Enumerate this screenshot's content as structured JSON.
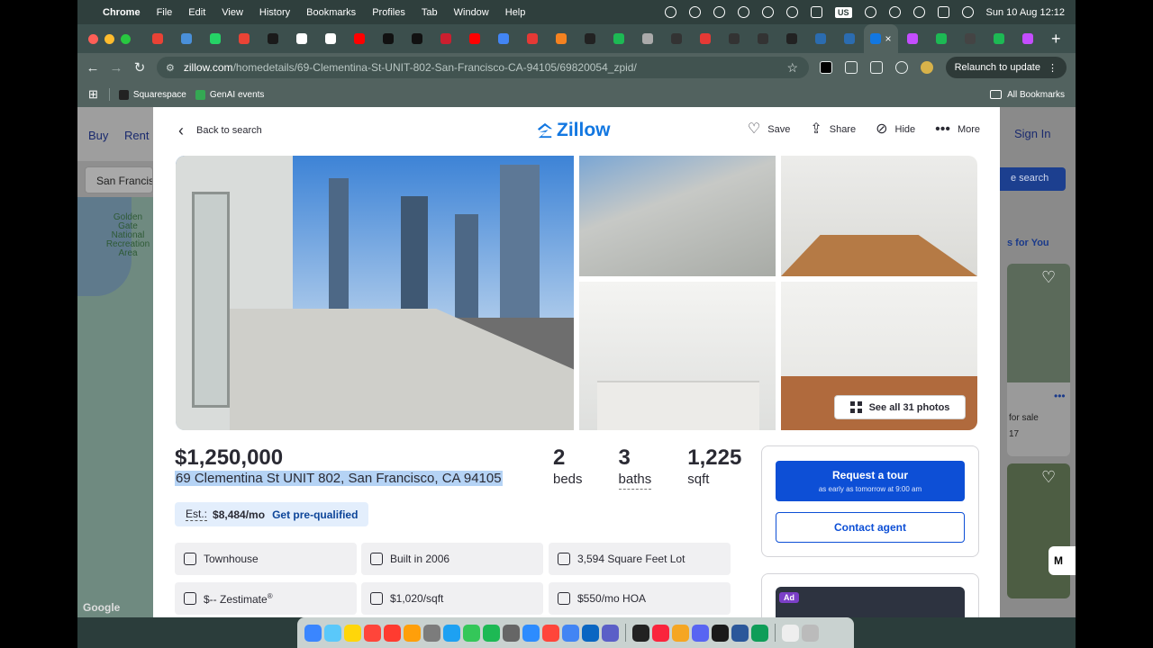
{
  "menubar": {
    "app": "Chrome",
    "items": [
      "File",
      "Edit",
      "View",
      "History",
      "Bookmarks",
      "Profiles",
      "Tab",
      "Window",
      "Help"
    ],
    "input_source": "US",
    "clock": "Sun 10 Aug  12:12"
  },
  "tabs": {
    "favicon_colors": [
      "#e94235",
      "#4a90d9",
      "#25d366",
      "#ea4335",
      "#1a1a1a",
      "#ffffff",
      "#ffffff",
      "#ff0000",
      "#111111",
      "#111111",
      "#cc1f2f",
      "#ff0000",
      "#4285f4",
      "#e53935",
      "#f58220",
      "#222222",
      "#1db954",
      "#aaaaaa",
      "#333333",
      "#e53935",
      "#333333",
      "#333333",
      "#222222",
      "#2b6cb0",
      "#2b6cb0"
    ],
    "active_favicon_color": "#1277e1",
    "after_colors": [
      "#c44dff",
      "#1db954",
      "#444444",
      "#1db954",
      "#c44dff"
    ],
    "new_tab": "+"
  },
  "toolbar": {
    "url_host": "zillow.com",
    "url_path": "/homedetails/69-Clementina-St-UNIT-802-San-Francisco-CA-94105/69820054_zpid/",
    "relaunch": "Relaunch to update"
  },
  "bookmarks": {
    "items": [
      "Squarespace",
      "GenAI events"
    ],
    "all": "All Bookmarks"
  },
  "background_page": {
    "nav_buy": "Buy",
    "nav_rent": "Rent",
    "search_value": "San Francis",
    "map_label": "Golden Gate National Recreation Area",
    "map_attribution": "Google",
    "sign_in": "Sign In",
    "search_button": "e search",
    "homes_for_you": "s for You",
    "card_for_sale": "for sale",
    "card_number": "17"
  },
  "modal": {
    "back": "Back to search",
    "brand": "Zillow",
    "actions": {
      "save": "Save",
      "share": "Share",
      "hide": "Hide",
      "more": "More"
    },
    "see_all_photos": "See all 31 photos",
    "price": "$1,250,000",
    "address": "69 Clementina St UNIT 802, San Francisco, CA 94105",
    "facts": {
      "beds": {
        "value": "2",
        "label": "beds"
      },
      "baths": {
        "value": "3",
        "label": "baths"
      },
      "sqft": {
        "value": "1,225",
        "label": "sqft"
      }
    },
    "estimate": {
      "label": "Est.:",
      "value": "$8,484/mo",
      "cta": "Get pre-qualified"
    },
    "chips": {
      "type": "Townhouse",
      "built": "Built in 2006",
      "lot": "3,594 Square Feet Lot",
      "zestimate": "$-- Zestimate",
      "zestimate_mark": "®",
      "price_per_sqft": "$1,020/sqft",
      "hoa": "$550/mo HOA"
    },
    "tour": {
      "request": "Request a tour",
      "request_sub": "as early as tomorrow at 9:00 am",
      "contact": "Contact agent"
    },
    "ad_badge": "Ad"
  },
  "dock": {
    "apps_colors": [
      "#3a86ff",
      "#5ac8fa",
      "#ffd60a",
      "#ff453a",
      "#ff3b30",
      "#ff9f0a",
      "#7c7c7c",
      "#1da1f2",
      "#34c759",
      "#1db954",
      "#666666",
      "#2d8cff",
      "#ff453a",
      "#4285f4",
      "#0a66c2",
      "#5b5fc7"
    ],
    "apps2_colors": [
      "#222222",
      "#fa243c",
      "#f5a623",
      "#5865f2",
      "#1a1a1a",
      "#2b579a",
      "#0f9d58"
    ],
    "trash_colors": [
      "#eeeeee",
      "#bbbbbb"
    ]
  }
}
